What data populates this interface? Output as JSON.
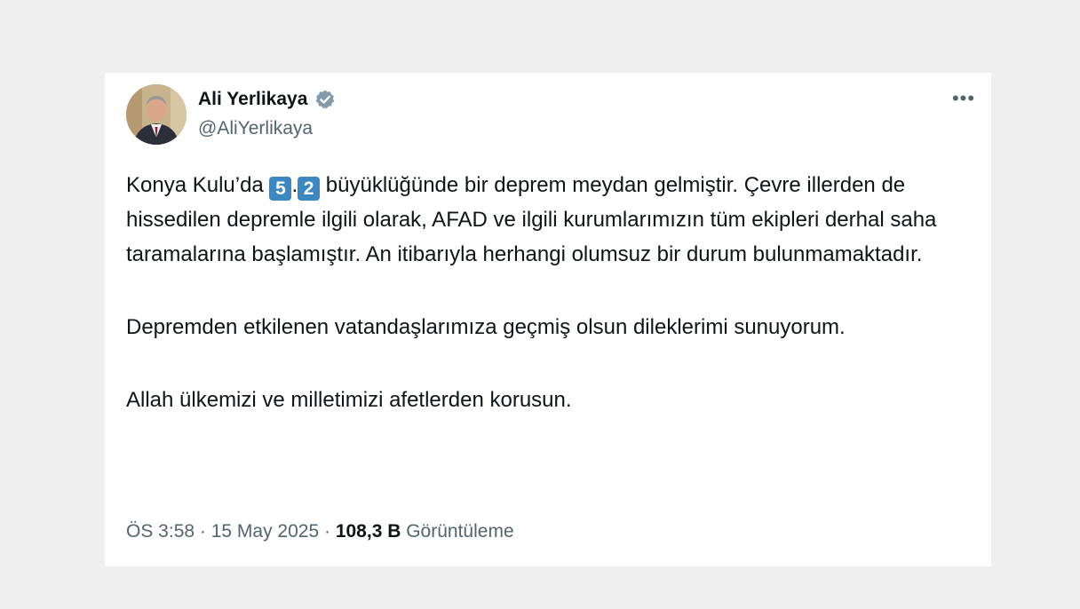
{
  "author": {
    "name": "Ali Yerlikaya",
    "handle": "@AliYerlikaya",
    "verified": true
  },
  "tweet": {
    "p1_before": "Konya Kulu’da ",
    "keycap_1": "5",
    "keycap_sep": ".",
    "keycap_2": "2",
    "p1_after": " büyüklüğünde bir deprem meydan gelmiştir. Çevre illerden de hissedilen depremle ilgili olarak, AFAD ve ilgili kurumlarımızın tüm ekipleri derhal saha taramalarına başlamıştır. An itibarıyla herhangi olumsuz bir durum bulunmamaktadır.",
    "p2": "Depremden etkilenen vatandaşlarımıza geçmiş olsun dileklerimi sunuyorum.",
    "p3": "Allah ülkemizi ve milletimizi afetlerden korusun."
  },
  "meta": {
    "time": "ÖS 3:58",
    "sep1": " · ",
    "date": "15 May 2025",
    "sep2": " · ",
    "views_count": "108,3 B",
    "views_label": " Görüntüleme"
  },
  "icons": {
    "more": "more-options-icon",
    "verified": "verified-badge-icon"
  },
  "colors": {
    "verified_badge": "#829aab",
    "keycap": "#3b88c3",
    "text": "#0f1419",
    "muted": "#536471"
  }
}
